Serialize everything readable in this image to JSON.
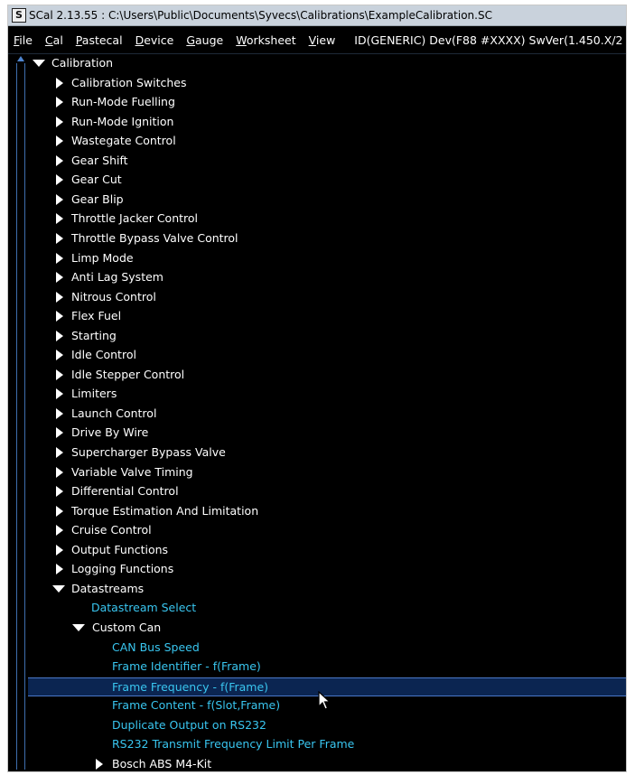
{
  "window": {
    "title": "SCal 2.13.55  :  C:\\Users\\Public\\Documents\\Syvecs\\Calibrations\\ExampleCalibration.SC",
    "app_icon": "S"
  },
  "menubar": {
    "items": [
      {
        "hotkey": "F",
        "rest": "ile"
      },
      {
        "hotkey": "C",
        "rest": "al"
      },
      {
        "hotkey": "P",
        "rest": "astecal"
      },
      {
        "hotkey": "D",
        "rest": "evice"
      },
      {
        "hotkey": "G",
        "rest": "auge"
      },
      {
        "hotkey": "W",
        "rest": "orksheet"
      },
      {
        "hotkey": "V",
        "rest": "iew"
      }
    ],
    "info": "ID(GENERIC)  Dev(F88 #XXXX)  SwVer(1.450.X/2"
  },
  "tree": {
    "root": "Calibration",
    "groups": [
      "Calibration Switches",
      "Run-Mode Fuelling",
      "Run-Mode Ignition",
      "Wastegate Control",
      "Gear Shift",
      "Gear Cut",
      "Gear Blip",
      "Throttle Jacker Control",
      "Throttle Bypass Valve Control",
      "Limp Mode",
      "Anti Lag System",
      "Nitrous Control",
      "Flex Fuel",
      "Starting",
      "Idle Control",
      "Idle Stepper Control",
      "Limiters",
      "Launch Control",
      "Drive By Wire",
      "Supercharger Bypass Valve",
      "Variable Valve Timing",
      "Differential Control",
      "Torque Estimation And Limitation",
      "Cruise Control",
      "Output Functions",
      "Logging Functions"
    ],
    "datastreams": {
      "label": "Datastreams",
      "select": "Datastream Select",
      "custom_can": {
        "label": "Custom Can",
        "items": [
          "CAN Bus Speed",
          "Frame Identifier - f(Frame)",
          "Frame Frequency - f(Frame)",
          "Frame Content - f(Slot,Frame)",
          "Duplicate Output on RS232",
          "RS232 Transmit Frequency Limit Per Frame"
        ],
        "selected_index": 2
      },
      "bosch": "Bosch ABS M4-Kit"
    }
  },
  "colors": {
    "background": "#000000",
    "text": "#ffffff",
    "leaf_text": "#39c6f0",
    "selection": "#0b2551",
    "selection_border": "#4a78c8",
    "titlebar": "#c9d2dc"
  },
  "icons": [
    "app-icon",
    "expand-arrow-icon",
    "collapse-arrow-icon",
    "scroll-up-icon",
    "mouse-pointer-icon"
  ]
}
